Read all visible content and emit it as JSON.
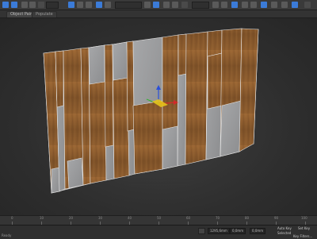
{
  "tabs": [
    {
      "label": "Object Paint"
    },
    {
      "label": "Populate"
    }
  ],
  "timeline": {
    "ticks": [
      "0",
      "10",
      "20",
      "30",
      "40",
      "50",
      "60",
      "70",
      "80",
      "90",
      "100"
    ]
  },
  "status": {
    "left_text": "Ready"
  },
  "coords": {
    "x": "1295,6mm",
    "y": "0,0mm",
    "z": "0,0mm"
  },
  "right_panel": {
    "label1": "Auto Key",
    "label2": "Selected",
    "label3": "Set Key",
    "label4": "Key Filters..."
  },
  "colors": {
    "wood": "#8a5a2e",
    "concrete": "#9a9b9d",
    "accent": "#3b7bd8"
  }
}
